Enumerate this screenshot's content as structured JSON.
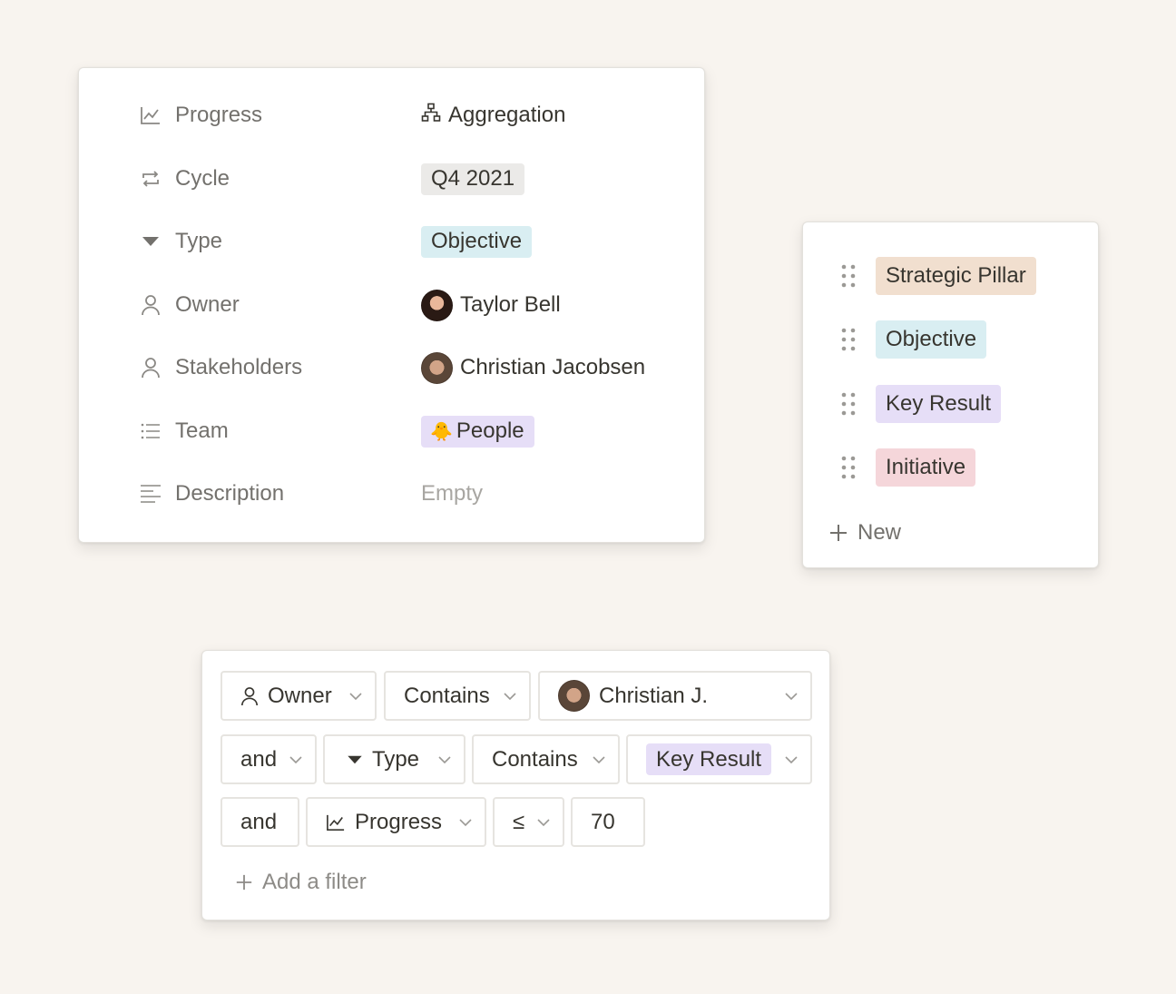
{
  "properties": {
    "rows": [
      {
        "label": "Progress",
        "icon": "chart-line-icon",
        "value": "Aggregation",
        "value_icon": "hierarchy-icon"
      },
      {
        "label": "Cycle",
        "icon": "repeat-icon",
        "value": "Q4 2021"
      },
      {
        "label": "Type",
        "icon": "triangle-down-icon",
        "value": "Objective"
      },
      {
        "label": "Owner",
        "icon": "person-icon",
        "value": "Taylor Bell"
      },
      {
        "label": "Stakeholders",
        "icon": "person-icon",
        "value": "Christian Jacobsen"
      },
      {
        "label": "Team",
        "icon": "list-icon",
        "value": "People",
        "value_emoji": "🐥"
      },
      {
        "label": "Description",
        "icon": "text-lines-icon",
        "value": "Empty"
      }
    ]
  },
  "options": {
    "items": [
      {
        "label": "Strategic Pillar",
        "color": "#f1dfcf"
      },
      {
        "label": "Objective",
        "color": "#d9eef2"
      },
      {
        "label": "Key Result",
        "color": "#e6def7"
      },
      {
        "label": "Initiative",
        "color": "#f5d6da"
      }
    ],
    "new_label": "New"
  },
  "filters": {
    "row1": {
      "property": "Owner",
      "operator": "Contains",
      "value": "Christian J."
    },
    "row2": {
      "conjunction": "and",
      "property": "Type",
      "operator": "Contains",
      "value": "Key Result"
    },
    "row3": {
      "conjunction": "and",
      "property": "Progress",
      "operator": "≤",
      "value": "70"
    },
    "add_label": "Add a filter"
  },
  "colors": {
    "cycle_tag": "#ebeae8",
    "objective_tag": "#d9eef2",
    "people_tag": "#e6def7",
    "key_result_tag": "#e6def7"
  }
}
